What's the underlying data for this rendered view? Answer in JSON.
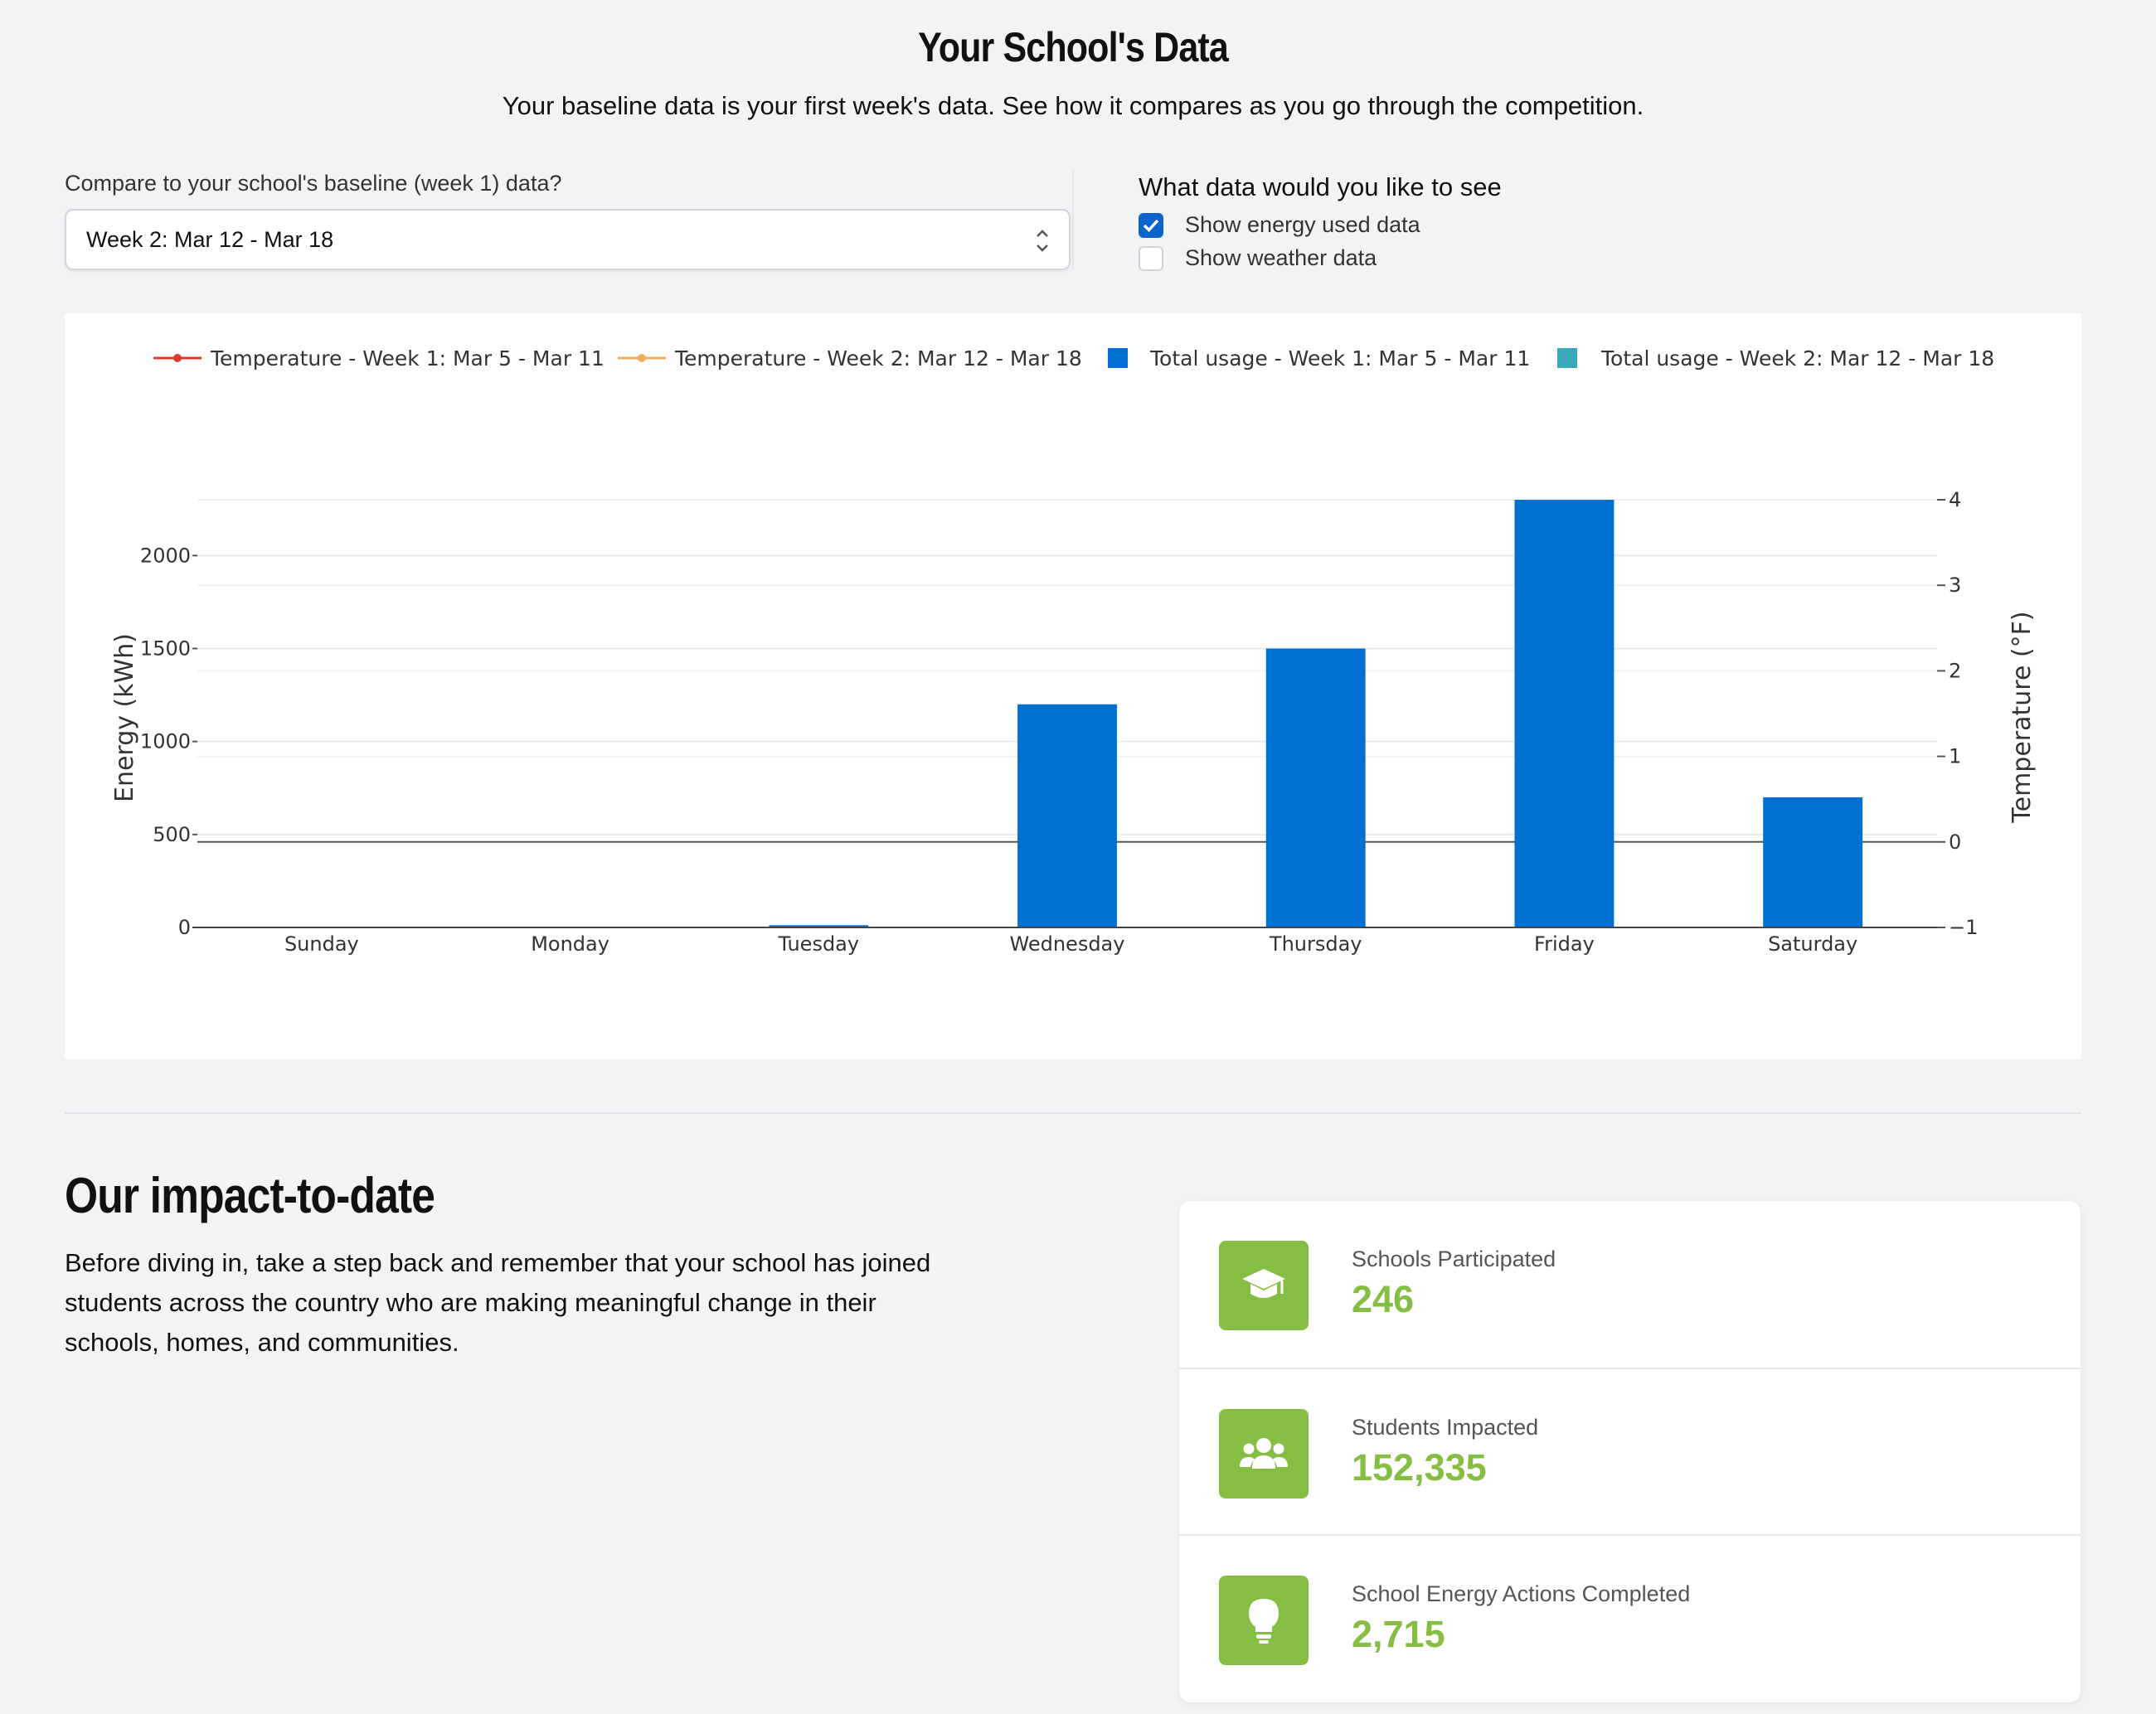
{
  "header": {
    "title": "Your School's Data",
    "subtitle": "Your baseline data is your first week's data. See how it compares as you go through the competition."
  },
  "compare": {
    "label": "Compare to your school's baseline (week 1) data?",
    "selected": "Week 2: Mar 12 - Mar 18"
  },
  "data_options": {
    "title": "What data would you like to see",
    "options": [
      {
        "label": "Show energy used data",
        "checked": true
      },
      {
        "label": "Show weather data",
        "checked": false
      }
    ]
  },
  "chart_data": {
    "type": "bar",
    "categories": [
      "Sunday",
      "Monday",
      "Tuesday",
      "Wednesday",
      "Thursday",
      "Friday",
      "Saturday"
    ],
    "series": [
      {
        "name": "Total usage - Week 1: Mar 5 - Mar 11",
        "color": "#0070d2",
        "values": [
          0,
          0,
          12,
          1200,
          1500,
          2300,
          700
        ]
      },
      {
        "name": "Total usage - Week 2: Mar 12 - Mar 18",
        "color": "#3aaab8",
        "values": [
          0,
          0,
          0,
          0,
          0,
          0,
          0
        ]
      }
    ],
    "line_series": [
      {
        "name": "Temperature - Week 1: Mar 5 - Mar 11",
        "color": "#e03a2a",
        "values": []
      },
      {
        "name": "Temperature - Week 2: Mar 12 - Mar 18",
        "color": "#f0ad5c",
        "values": []
      }
    ],
    "ylabel": "Energy (kWh)",
    "y2label": "Temperature (°F)",
    "ylim": [
      0,
      2300
    ],
    "yticks": [
      0,
      500,
      1000,
      1500,
      2000
    ],
    "y2lim": [
      -1,
      4
    ],
    "y2ticks": [
      -1,
      0,
      1,
      2,
      3,
      4
    ],
    "y2tick_labels": [
      "−1",
      "0",
      "1",
      "2",
      "3",
      "4"
    ],
    "legend_position": "top",
    "grid": true
  },
  "impact": {
    "title": "Our impact-to-date",
    "body": "Before diving in, take a step back and remember that your school has joined students across the country who are making meaningful change in their schools, homes, and communities.",
    "stats": [
      {
        "label": "Schools Participated",
        "value": "246",
        "icon": "graduation-cap-icon"
      },
      {
        "label": "Students Impacted",
        "value": "152,335",
        "icon": "users-icon"
      },
      {
        "label": "School Energy Actions Completed",
        "value": "2,715",
        "icon": "lightbulb-icon"
      }
    ],
    "accent": "#86bd43"
  }
}
